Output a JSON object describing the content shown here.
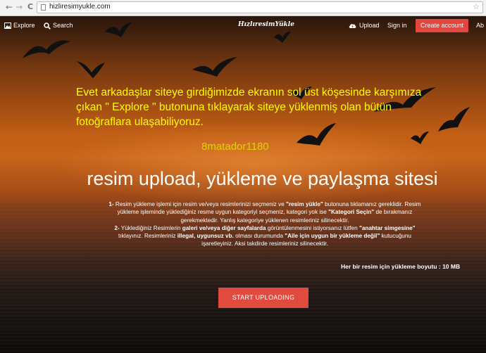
{
  "browser": {
    "url": "hizliresimyukle.com",
    "back_glyph": "←",
    "forward_glyph": "→",
    "reload_glyph": "C",
    "star_glyph": "☆"
  },
  "nav": {
    "explore_label": "Explore",
    "search_label": "Search",
    "logo_text": "HızlıresimYükle",
    "upload_label": "Upload",
    "signin_label": "Sign in",
    "create_account_label": "Create account",
    "overflow_label": "Ab"
  },
  "annotation": {
    "text": "Evet arkadaşlar siteye girdiğimizde ekranın sol üst köşesinde karşımıza çıkan \" Explore \" butonuna tıklayarak siteye yüklenmiş olan bütün fotoğraflara ulaşabiliyoruz.",
    "watermark": "8matador1180"
  },
  "hero": {
    "headline": "resim upload, yükleme ve paylaşma sitesi",
    "desc": {
      "p1_num": "1-",
      "p1_a": " Resim yükleme işlemi için resim ve/veya resimlerinizi seçmeniz ve ",
      "p1_b": "\"resim yükle\"",
      "p1_c": " butonuna tıklamanız gereklidir. Resim yükleme işleminde yüklediğiniz resme uygun kategoriyi seçmeniz, kategori yok ise ",
      "p1_d": "\"Kategori Seçin\"",
      "p1_e": " de bırakmanız gerekmektedir. Yanlış kategoriye yüklenen resimleriniz silinecektir.",
      "p2_num": "2-",
      "p2_a": " Yüklediğiniz Resimlerin ",
      "p2_b": "galeri ve/veya diğer sayfalarda",
      "p2_c": " görüntülenmesini istiyorsanız lütfen ",
      "p2_d": "\"anahtar simgesine\"",
      "p2_e": " tıklayınız. Resimleriniz ",
      "p2_f": "illegal, uygunsuz vb.",
      "p2_g": " olması durumunda ",
      "p2_h": "\"Aile için uygun bir yükleme değil\"",
      "p2_i": " kutucuğunu işaretleyiniz. Aksi takdirde resimleriniz silinecektir."
    },
    "size_limit": "Her bir resim için yükleme boyutu : 10 MB",
    "cta_label": "START UPLOADING"
  },
  "colors": {
    "accent": "#e14a3f",
    "annotation": "#ffff00"
  },
  "icons": [
    "image-icon",
    "search-icon",
    "cloud-upload-icon",
    "star-icon",
    "page-icon"
  ]
}
